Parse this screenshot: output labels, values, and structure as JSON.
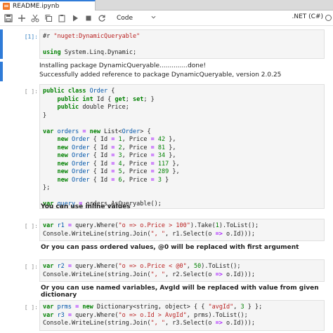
{
  "tab": {
    "title": "README.ipynb"
  },
  "toolbar": {
    "cell_type": "Code",
    "kernel": ".NET (C#)"
  },
  "cells": {
    "c1": {
      "prompt": "[1]:",
      "code": [
        [
          [
            "p",
            "#r "
          ],
          [
            "s",
            "\"nuget:DynamicQueryable\""
          ]
        ],
        [
          [
            "p",
            ""
          ]
        ],
        [
          [
            "k",
            "using"
          ],
          [
            "p",
            " System.Linq.Dynamic;"
          ]
        ]
      ],
      "output": [
        "Installing package DynamicQueryable..............done!",
        "Successfully added reference to package DynamicQueryable, version 2.0.25"
      ]
    },
    "c2": {
      "prompt": "[ ]:",
      "code": [
        [
          [
            "k",
            "public"
          ],
          [
            "p",
            " "
          ],
          [
            "k",
            "class"
          ],
          [
            "p",
            " "
          ],
          [
            "n",
            "Order"
          ],
          [
            "p",
            " {"
          ]
        ],
        [
          [
            "p",
            "    "
          ],
          [
            "k",
            "public"
          ],
          [
            "p",
            " "
          ],
          [
            "k",
            "int"
          ],
          [
            "p",
            " Id { "
          ],
          [
            "k",
            "get"
          ],
          [
            "p",
            "; "
          ],
          [
            "k",
            "set"
          ],
          [
            "p",
            "; }"
          ]
        ],
        [
          [
            "p",
            "    "
          ],
          [
            "k",
            "public"
          ],
          [
            "p",
            " double Price;"
          ]
        ],
        [
          [
            "p",
            "}"
          ]
        ],
        [
          [
            "p",
            ""
          ]
        ],
        [
          [
            "k",
            "var"
          ],
          [
            "p",
            " "
          ],
          [
            "n",
            "orders"
          ],
          [
            "p",
            " "
          ],
          [
            "o",
            "="
          ],
          [
            "p",
            " "
          ],
          [
            "k",
            "new"
          ],
          [
            "p",
            " List<"
          ],
          [
            "n",
            "Order"
          ],
          [
            "p",
            "> {"
          ]
        ],
        [
          [
            "p",
            "    "
          ],
          [
            "k",
            "new"
          ],
          [
            "p",
            " "
          ],
          [
            "n",
            "Order"
          ],
          [
            "p",
            " { Id "
          ],
          [
            "o",
            "="
          ],
          [
            "p",
            " "
          ],
          [
            "num",
            "1"
          ],
          [
            "p",
            ", Price "
          ],
          [
            "o",
            "="
          ],
          [
            "p",
            " "
          ],
          [
            "num",
            "42"
          ],
          [
            "p",
            " },"
          ]
        ],
        [
          [
            "p",
            "    "
          ],
          [
            "k",
            "new"
          ],
          [
            "p",
            " "
          ],
          [
            "n",
            "Order"
          ],
          [
            "p",
            " { Id "
          ],
          [
            "o",
            "="
          ],
          [
            "p",
            " "
          ],
          [
            "num",
            "2"
          ],
          [
            "p",
            ", Price "
          ],
          [
            "o",
            "="
          ],
          [
            "p",
            " "
          ],
          [
            "num",
            "81"
          ],
          [
            "p",
            " },"
          ]
        ],
        [
          [
            "p",
            "    "
          ],
          [
            "k",
            "new"
          ],
          [
            "p",
            " "
          ],
          [
            "n",
            "Order"
          ],
          [
            "p",
            " { Id "
          ],
          [
            "o",
            "="
          ],
          [
            "p",
            " "
          ],
          [
            "num",
            "3"
          ],
          [
            "p",
            ", Price "
          ],
          [
            "o",
            "="
          ],
          [
            "p",
            " "
          ],
          [
            "num",
            "34"
          ],
          [
            "p",
            " },"
          ]
        ],
        [
          [
            "p",
            "    "
          ],
          [
            "k",
            "new"
          ],
          [
            "p",
            " "
          ],
          [
            "n",
            "Order"
          ],
          [
            "p",
            " { Id "
          ],
          [
            "o",
            "="
          ],
          [
            "p",
            " "
          ],
          [
            "num",
            "4"
          ],
          [
            "p",
            ", Price "
          ],
          [
            "o",
            "="
          ],
          [
            "p",
            " "
          ],
          [
            "num",
            "117"
          ],
          [
            "p",
            " },"
          ]
        ],
        [
          [
            "p",
            "    "
          ],
          [
            "k",
            "new"
          ],
          [
            "p",
            " "
          ],
          [
            "n",
            "Order"
          ],
          [
            "p",
            " { Id "
          ],
          [
            "o",
            "="
          ],
          [
            "p",
            " "
          ],
          [
            "num",
            "5"
          ],
          [
            "p",
            ", Price "
          ],
          [
            "o",
            "="
          ],
          [
            "p",
            " "
          ],
          [
            "num",
            "289"
          ],
          [
            "p",
            " },"
          ]
        ],
        [
          [
            "p",
            "    "
          ],
          [
            "k",
            "new"
          ],
          [
            "p",
            " "
          ],
          [
            "n",
            "Order"
          ],
          [
            "p",
            " { Id "
          ],
          [
            "o",
            "="
          ],
          [
            "p",
            " "
          ],
          [
            "num",
            "6"
          ],
          [
            "p",
            ", Price "
          ],
          [
            "o",
            "="
          ],
          [
            "p",
            " "
          ],
          [
            "num",
            "3"
          ],
          [
            "p",
            " }"
          ]
        ],
        [
          [
            "p",
            "};"
          ]
        ],
        [
          [
            "p",
            ""
          ]
        ],
        [
          [
            "k",
            "var"
          ],
          [
            "p",
            " "
          ],
          [
            "n",
            "query"
          ],
          [
            "p",
            " "
          ],
          [
            "o",
            "="
          ],
          [
            "p",
            " orders.AsQueryable();"
          ]
        ]
      ]
    },
    "md1": "You can use inline values",
    "c3": {
      "prompt": "[ ]:",
      "code": [
        [
          [
            "k",
            "var"
          ],
          [
            "p",
            " "
          ],
          [
            "n",
            "r1"
          ],
          [
            "p",
            " "
          ],
          [
            "o",
            "="
          ],
          [
            "p",
            " query.Where("
          ],
          [
            "s",
            "\"o => o.Price > 100\""
          ],
          [
            "p",
            ").Take("
          ],
          [
            "num",
            "1"
          ],
          [
            "p",
            ").ToList();"
          ]
        ],
        [
          [
            "p",
            "Console.WriteLine(string.Join("
          ],
          [
            "s",
            "\", \""
          ],
          [
            "p",
            ", r1.Select(o "
          ],
          [
            "o",
            "=>"
          ],
          [
            "p",
            " o.Id)));"
          ]
        ]
      ]
    },
    "md2": "Or you can pass ordered values, @0 will be replaced with first argument",
    "c4": {
      "prompt": "[ ]:",
      "code": [
        [
          [
            "k",
            "var"
          ],
          [
            "p",
            " "
          ],
          [
            "n",
            "r2"
          ],
          [
            "p",
            " "
          ],
          [
            "o",
            "="
          ],
          [
            "p",
            " query.Where("
          ],
          [
            "s",
            "\"o => o.Price < @0\""
          ],
          [
            "p",
            ", "
          ],
          [
            "num",
            "50"
          ],
          [
            "p",
            ").ToList();"
          ]
        ],
        [
          [
            "p",
            "Console.WriteLine(string.Join("
          ],
          [
            "s",
            "\", \""
          ],
          [
            "p",
            ", r2.Select(o "
          ],
          [
            "o",
            "=>"
          ],
          [
            "p",
            " o.Id)));"
          ]
        ]
      ]
    },
    "md3": "Or you can use named variables, AvgId will be replaced with value from given dictionary",
    "c5": {
      "prompt": "[ ]:",
      "code": [
        [
          [
            "k",
            "var"
          ],
          [
            "p",
            " "
          ],
          [
            "n",
            "prms"
          ],
          [
            "p",
            " "
          ],
          [
            "o",
            "="
          ],
          [
            "p",
            " "
          ],
          [
            "k",
            "new"
          ],
          [
            "p",
            " Dictionary<string, object> { { "
          ],
          [
            "s",
            "\"avgId\""
          ],
          [
            "p",
            ", "
          ],
          [
            "num",
            "3"
          ],
          [
            "p",
            " } };"
          ]
        ],
        [
          [
            "k",
            "var"
          ],
          [
            "p",
            " "
          ],
          [
            "n",
            "r3"
          ],
          [
            "p",
            " "
          ],
          [
            "o",
            "="
          ],
          [
            "p",
            " query.Where("
          ],
          [
            "s",
            "\"o => o.Id > AvgId\""
          ],
          [
            "p",
            ", prms).ToList();"
          ]
        ],
        [
          [
            "p",
            "Console.WriteLine(string.Join("
          ],
          [
            "s",
            "\", \""
          ],
          [
            "p",
            ", r3.Select(o "
          ],
          [
            "o",
            "=>"
          ],
          [
            "p",
            " o.Id)));"
          ]
        ]
      ]
    }
  }
}
